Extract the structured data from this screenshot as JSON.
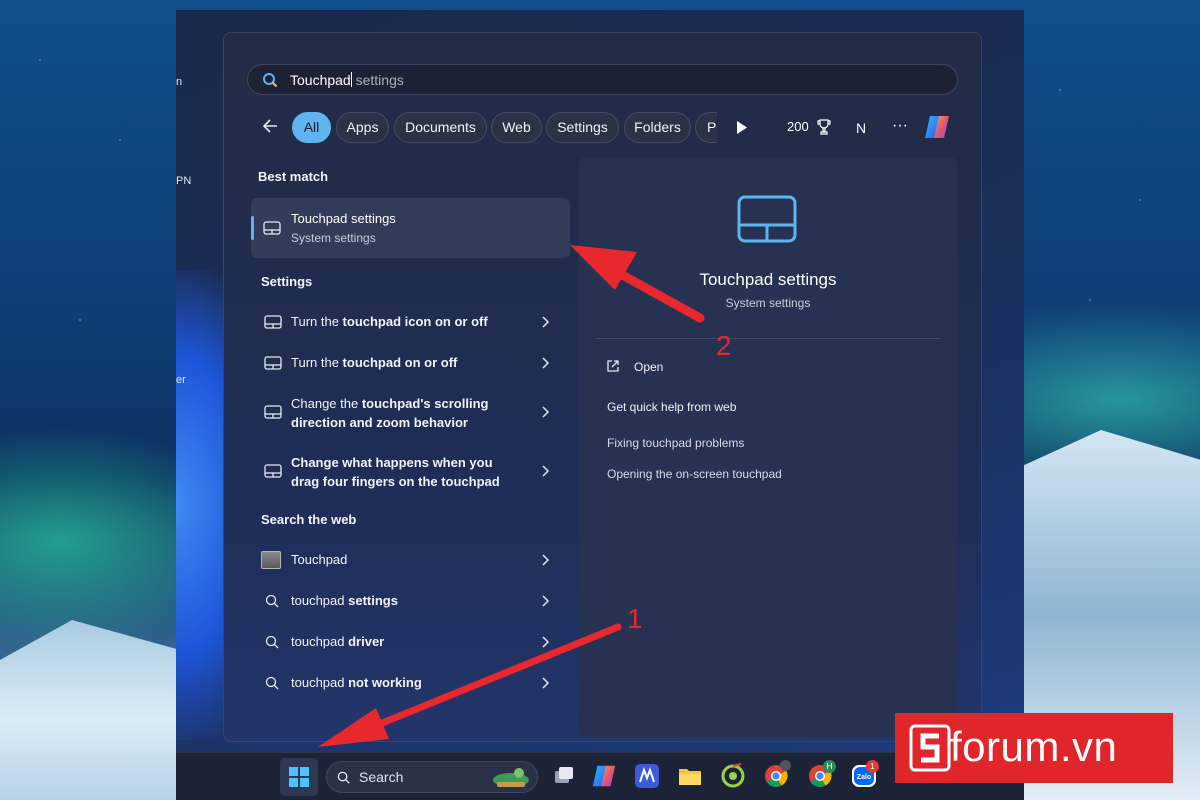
{
  "search": {
    "typed": "Touchpad",
    "hint": " settings"
  },
  "filters": {
    "chips": [
      "All",
      "Apps",
      "Documents",
      "Web",
      "Settings",
      "Folders",
      "Ph"
    ],
    "points": "200",
    "avatar_initial": "N",
    "more": "···"
  },
  "best_match": {
    "heading": "Best match",
    "title": "Touchpad settings",
    "subtitle": "System settings"
  },
  "settings_section": {
    "heading": "Settings",
    "items": [
      {
        "pre": "Turn the ",
        "bold": "touchpad icon on or off",
        "line2": ""
      },
      {
        "pre": "Turn the ",
        "bold": "touchpad on or off",
        "line2": ""
      },
      {
        "pre": "Change the ",
        "bold": "touchpad's scrolling",
        "line2": "direction and zoom behavior"
      },
      {
        "pre": "Change what happens when you",
        "bold": "",
        "line2": "drag four fingers on the touchpad"
      }
    ]
  },
  "web_section": {
    "heading": "Search the web",
    "items": [
      {
        "pre": "Touchpad",
        "bold": ""
      },
      {
        "pre": "touchpad ",
        "bold": "settings"
      },
      {
        "pre": "touchpad ",
        "bold": "driver"
      },
      {
        "pre": "touchpad ",
        "bold": "not working"
      }
    ]
  },
  "preview": {
    "title": "Touchpad settings",
    "subtitle": "System settings",
    "open": "Open",
    "help_heading": "Get quick help from web",
    "links": [
      "Fixing touchpad problems",
      "Opening the on-screen touchpad"
    ]
  },
  "taskbar": {
    "search_label": "Search",
    "badges": {
      "h": "H",
      "zalo": "1"
    },
    "zalo_label": "Zalo"
  },
  "annotations": {
    "step1": "1",
    "step2": "2"
  },
  "watermark": {
    "text": "forum.vn"
  },
  "desktop_labels": [
    "n",
    "PN",
    "er"
  ],
  "colors": {
    "accent": "#5fb4f0",
    "arrow": "#e8282c",
    "watermark": "#e0262b"
  }
}
